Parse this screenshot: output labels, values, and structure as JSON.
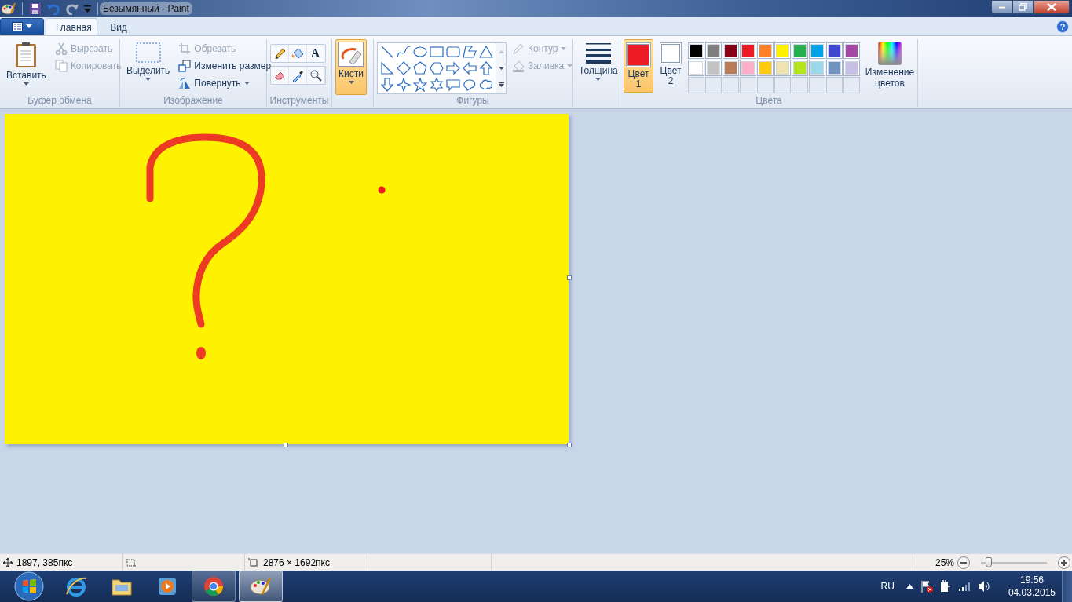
{
  "window": {
    "title": "Безымянный - Paint"
  },
  "tabs": [
    {
      "label": "Главная",
      "selected": true
    },
    {
      "label": "Вид",
      "selected": false
    }
  ],
  "ribbon": {
    "clipboard": {
      "label": "Буфер обмена",
      "paste": "Вставить",
      "cut": {
        "label": "Вырезать",
        "disabled": true
      },
      "copy": {
        "label": "Копировать",
        "disabled": true
      }
    },
    "image": {
      "label": "Изображение",
      "select": "Выделить",
      "crop": {
        "label": "Обрезать",
        "disabled": true
      },
      "resize": {
        "label": "Изменить размер",
        "disabled": false
      },
      "rotate": {
        "label": "Повернуть",
        "disabled": false
      }
    },
    "tools": {
      "label": "Инструменты",
      "text_tool": "A"
    },
    "brushes": {
      "label": "Кисти",
      "selected": true
    },
    "shapes": {
      "label": "Фигуры",
      "outline": {
        "label": "Контур",
        "disabled": true
      },
      "fill": {
        "label": "Заливка",
        "disabled": true
      }
    },
    "size": {
      "label": "Толщина"
    },
    "colors": {
      "label": "Цвета",
      "color1": {
        "label": "Цвет 1",
        "color": "#ed1c24",
        "selected": true
      },
      "color2": {
        "label": "Цвет 2",
        "color": "#ffffff",
        "selected": false
      },
      "palette": [
        {
          "color": "#000000"
        },
        {
          "color": "#7f7f7f"
        },
        {
          "color": "#880015"
        },
        {
          "color": "#ed1c24"
        },
        {
          "color": "#ff7f27"
        },
        {
          "color": "#fff200"
        },
        {
          "color": "#22b14c"
        },
        {
          "color": "#00a2e8"
        },
        {
          "color": "#3f48cc"
        },
        {
          "color": "#a349a4"
        },
        {
          "color": "#ffffff"
        },
        {
          "color": "#c3c3c3"
        },
        {
          "color": "#b97a57"
        },
        {
          "color": "#ffaec9"
        },
        {
          "color": "#ffc90e"
        },
        {
          "color": "#efe4b0"
        },
        {
          "color": "#b5e61d"
        },
        {
          "color": "#99d9ea"
        },
        {
          "color": "#7092be"
        },
        {
          "color": "#c8bfe7"
        }
      ],
      "edit": "Изменение цветов"
    }
  },
  "status_bar": {
    "position": "1897, 385пкс",
    "size": "2876 × 1692пкс",
    "zoom": "25%",
    "zoom_slider": {
      "level": 0.12
    }
  },
  "help": "?",
  "taskbar": {
    "language": "RU",
    "time": "19:56",
    "date": "04.03.2015"
  }
}
